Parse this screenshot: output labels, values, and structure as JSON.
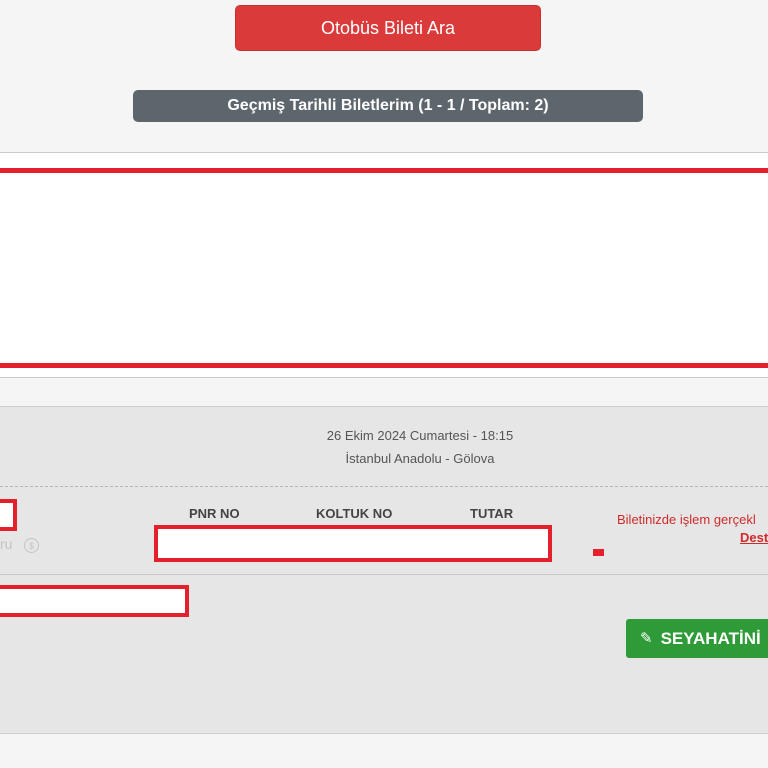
{
  "search": {
    "button_label": "Otobüs Bileti Ara"
  },
  "history": {
    "title": "Geçmiş Tarihli Biletlerim (1 - 1 / Toplam: 2)"
  },
  "ticket": {
    "date": "26 Ekim 2024 Cumartesi - 18:15",
    "route": "İstanbul Anadolu - Gölova",
    "columns": [
      "PNR NO",
      "KOLTUK NO",
      "TUTAR"
    ],
    "faded_label": "ru",
    "notice": "Biletinizde işlem gerçekl",
    "notice_link": "Dest",
    "edit_button": "SEYAHATİNİ",
    "icons": {
      "edit": "pencil-icon",
      "info": "info-icon"
    }
  },
  "colors": {
    "search_button": "#db3a3a",
    "history_bar": "#5e666d",
    "edit_button": "#2e9b38",
    "redaction": "#e3202b",
    "notice": "#d12a2a"
  }
}
